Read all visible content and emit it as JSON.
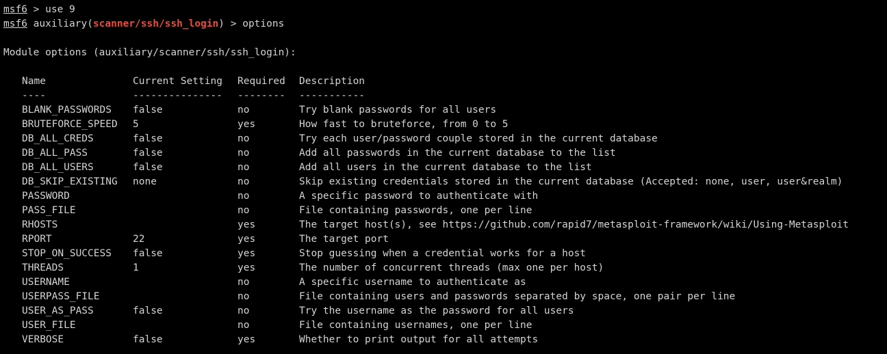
{
  "commands": [
    {
      "prompt": "msf6",
      "context_prefix": "",
      "module": "",
      "context_suffix": "",
      "separator": " > ",
      "command": "use 9"
    },
    {
      "prompt": "msf6",
      "context_prefix": " auxiliary(",
      "module": "scanner/ssh/ssh_login",
      "context_suffix": ")",
      "separator": " > ",
      "command": "options"
    }
  ],
  "module_options_heading": "Module options (auxiliary/scanner/ssh/ssh_login):",
  "table": {
    "headers": [
      "Name",
      "Current Setting",
      "Required",
      "Description"
    ],
    "underlines": [
      "----",
      "---------------",
      "--------",
      "-----------"
    ],
    "rows": [
      [
        "BLANK_PASSWORDS",
        "false",
        "no",
        "Try blank passwords for all users"
      ],
      [
        "BRUTEFORCE_SPEED",
        "5",
        "yes",
        "How fast to bruteforce, from 0 to 5"
      ],
      [
        "DB_ALL_CREDS",
        "false",
        "no",
        "Try each user/password couple stored in the current database"
      ],
      [
        "DB_ALL_PASS",
        "false",
        "no",
        "Add all passwords in the current database to the list"
      ],
      [
        "DB_ALL_USERS",
        "false",
        "no",
        "Add all users in the current database to the list"
      ],
      [
        "DB_SKIP_EXISTING",
        "none",
        "no",
        "Skip existing credentials stored in the current database (Accepted: none, user, user&realm)"
      ],
      [
        "PASSWORD",
        "",
        "no",
        "A specific password to authenticate with"
      ],
      [
        "PASS_FILE",
        "",
        "no",
        "File containing passwords, one per line"
      ],
      [
        "RHOSTS",
        "",
        "yes",
        "The target host(s), see https://github.com/rapid7/metasploit-framework/wiki/Using-Metasploit"
      ],
      [
        "RPORT",
        "22",
        "yes",
        "The target port"
      ],
      [
        "STOP_ON_SUCCESS",
        "false",
        "yes",
        "Stop guessing when a credential works for a host"
      ],
      [
        "THREADS",
        "1",
        "yes",
        "The number of concurrent threads (max one per host)"
      ],
      [
        "USERNAME",
        "",
        "no",
        "A specific username to authenticate as"
      ],
      [
        "USERPASS_FILE",
        "",
        "no",
        "File containing users and passwords separated by space, one pair per line"
      ],
      [
        "USER_AS_PASS",
        "false",
        "no",
        "Try the username as the password for all users"
      ],
      [
        "USER_FILE",
        "",
        "no",
        "File containing usernames, one per line"
      ],
      [
        "VERBOSE",
        "false",
        "yes",
        "Whether to print output for all attempts"
      ]
    ]
  },
  "colors": {
    "background": "#000000",
    "foreground": "#d4d4d4",
    "module_highlight": "#e74c3c"
  }
}
